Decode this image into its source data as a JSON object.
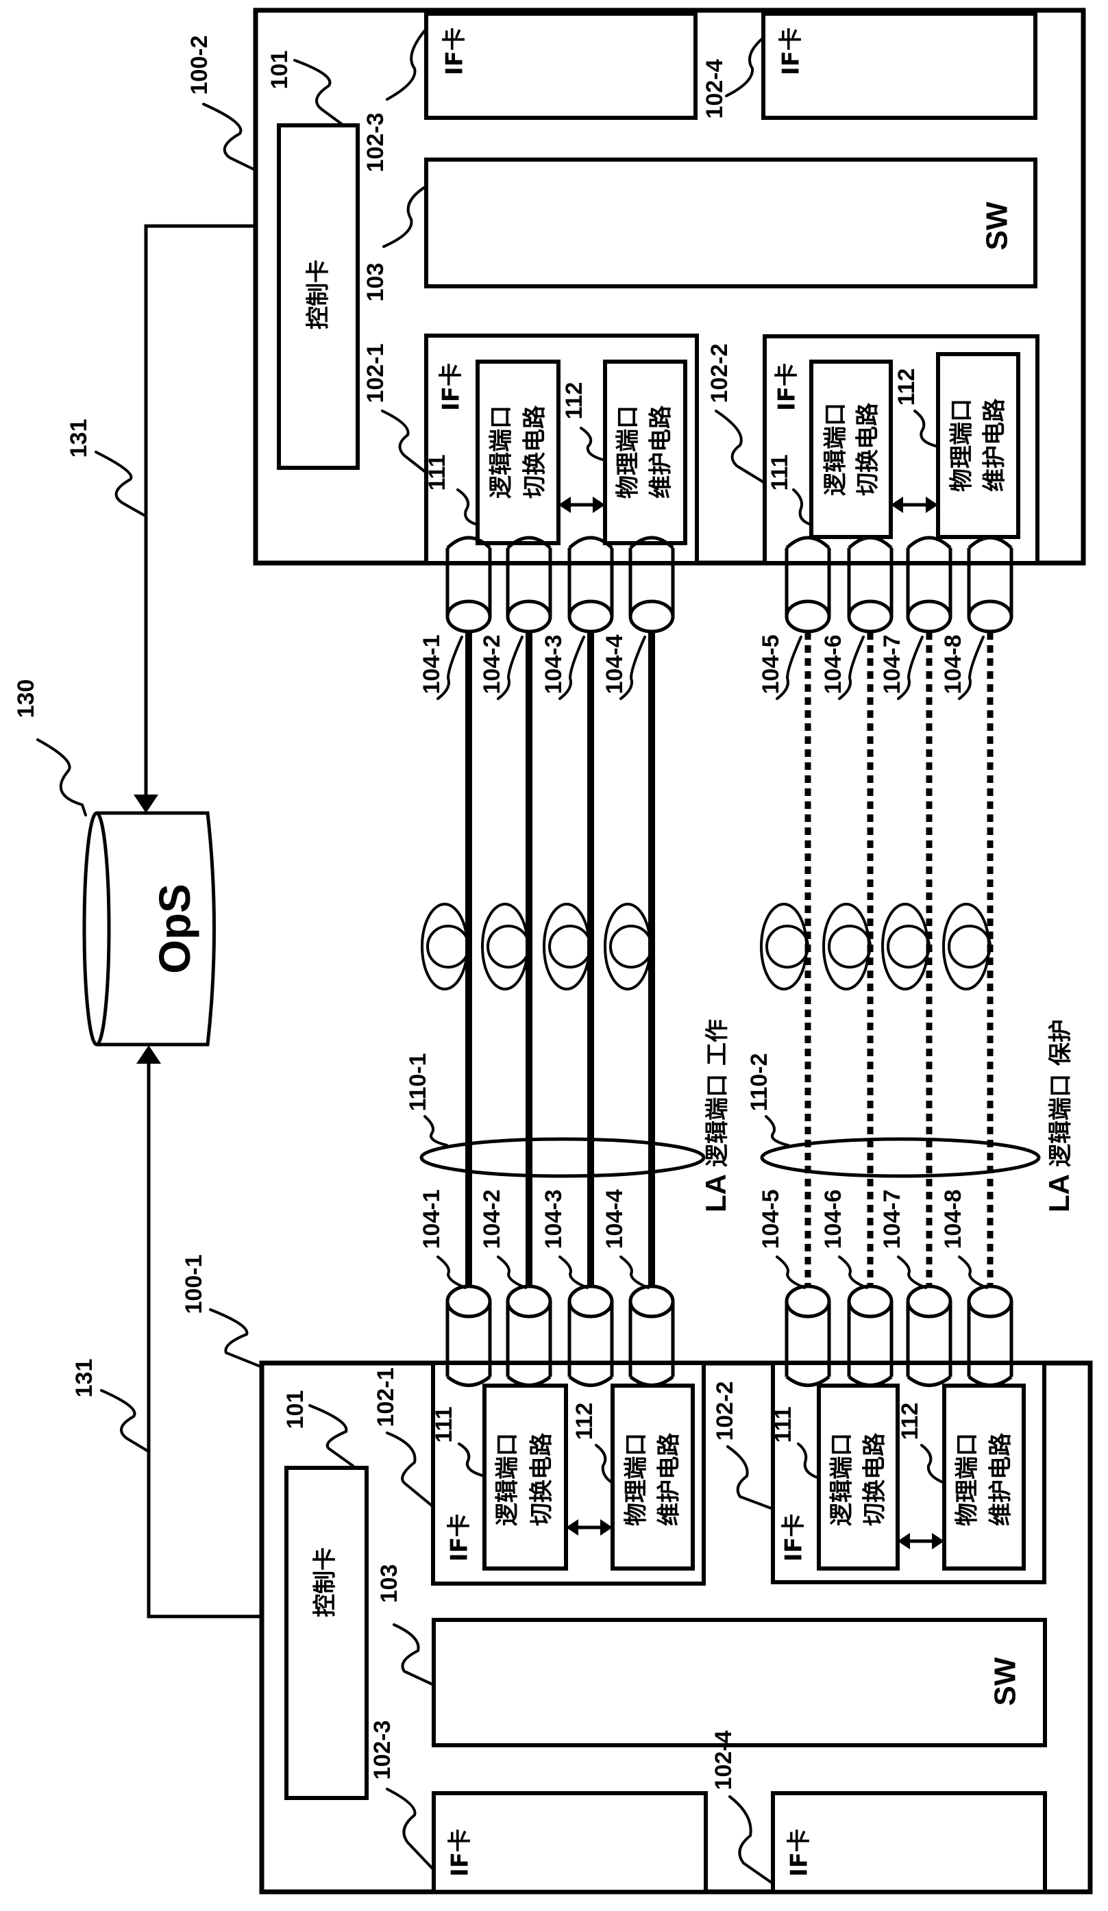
{
  "figure": {
    "type": "network device block diagram (link aggregation protection)",
    "ops": {
      "label": "OpS",
      "ref": "130"
    },
    "mgmt_link_ref": "131",
    "devices": [
      {
        "id": "top",
        "ref": "100-2",
        "control_card": {
          "ref": "101",
          "label": "控制卡"
        },
        "switch": {
          "ref": "103",
          "label": "SW"
        },
        "if_cards": [
          {
            "ref": "102-1",
            "label": "IF卡",
            "logic_circuit": {
              "ref": "111",
              "line1": "逻辑端口",
              "line2": "切换电路"
            },
            "phys_circuit": {
              "ref": "112",
              "line1": "物理端口",
              "line2": "维护电路"
            }
          },
          {
            "ref": "102-2",
            "label": "IF卡",
            "logic_circuit": {
              "ref": "111",
              "line1": "逻辑端口",
              "line2": "切换电路"
            },
            "phys_circuit": {
              "ref": "112",
              "line1": "物理端口",
              "line2": "维护电路"
            }
          },
          {
            "ref": "102-3",
            "label": "IF卡"
          },
          {
            "ref": "102-4",
            "label": "IF卡"
          }
        ]
      },
      {
        "id": "bottom",
        "ref": "100-1",
        "control_card": {
          "ref": "101",
          "label": "控制卡"
        },
        "switch": {
          "ref": "103",
          "label": "SW"
        },
        "if_cards": [
          {
            "ref": "102-1",
            "label": "IF卡",
            "logic_circuit": {
              "ref": "111",
              "line1": "逻辑端口",
              "line2": "切换电路"
            },
            "phys_circuit": {
              "ref": "112",
              "line1": "物理端口",
              "line2": "维护电路"
            }
          },
          {
            "ref": "102-2",
            "label": "IF卡",
            "logic_circuit": {
              "ref": "111",
              "line1": "逻辑端口",
              "line2": "切换电路"
            },
            "phys_circuit": {
              "ref": "112",
              "line1": "物理端口",
              "line2": "维护电路"
            }
          },
          {
            "ref": "102-3",
            "label": "IF卡"
          },
          {
            "ref": "102-4",
            "label": "IF卡"
          }
        ]
      }
    ],
    "ports": [
      "104-1",
      "104-2",
      "104-3",
      "104-4",
      "104-5",
      "104-6",
      "104-7",
      "104-8"
    ],
    "lag_groups": [
      {
        "ref": "110-1",
        "label_prefix": "LA",
        "label_main": "逻辑端口",
        "label_role": "工作",
        "line_style": "solid",
        "ports": [
          "104-1",
          "104-2",
          "104-3",
          "104-4"
        ]
      },
      {
        "ref": "110-2",
        "label_prefix": "LA",
        "label_main": "逻辑端口",
        "label_role": "保护",
        "line_style": "dotted",
        "ports": [
          "104-5",
          "104-6",
          "104-7",
          "104-8"
        ]
      }
    ]
  }
}
